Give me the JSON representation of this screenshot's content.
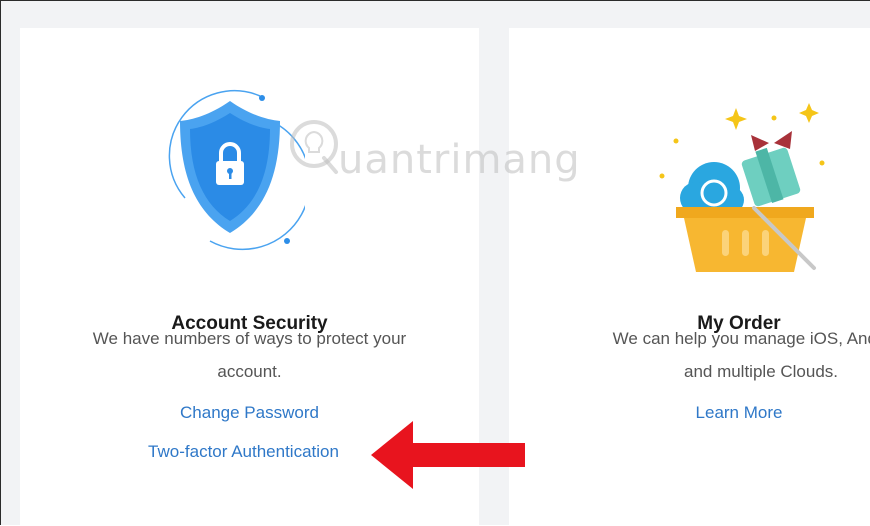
{
  "cards": [
    {
      "title": "Account Security",
      "description_line1": "We have numbers of ways to protect your",
      "description_line2": "account.",
      "links": [
        "Change Password",
        "Two-factor Authentication"
      ],
      "icon": "shield-lock-icon"
    },
    {
      "title": "My Order",
      "description_line1": "We can help you manage iOS, Android",
      "description_line2": "and multiple Clouds.",
      "links": [
        "Learn More"
      ],
      "icon": "basket-gift-icon"
    }
  ],
  "watermark": {
    "text": "uantrimang",
    "icon": "lightbulb-q-icon"
  },
  "annotation": {
    "icon": "red-arrow-left-icon",
    "color": "#e8141e"
  },
  "colors": {
    "link": "#2f78c8",
    "background": "#f2f3f5",
    "card": "#ffffff"
  }
}
